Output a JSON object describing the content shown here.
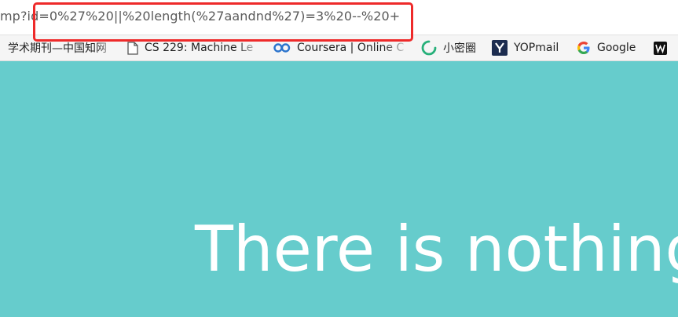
{
  "address_bar": {
    "url": "mp?id=0%27%20||%20length(%27aandnd%27)=3%20--%20+"
  },
  "bookmarks": [
    {
      "label": "学术期刊—中国知网",
      "icon": "cnki-icon"
    },
    {
      "label": "CS 229: Machine Le",
      "icon": "document-icon"
    },
    {
      "label": "Coursera | Online C",
      "icon": "coursera-icon"
    },
    {
      "label": "小密圈",
      "icon": "xiaomiquan-icon"
    },
    {
      "label": "YOPmail",
      "icon": "yopmail-icon"
    },
    {
      "label": "Google",
      "icon": "google-icon"
    },
    {
      "label": "",
      "icon": "wordpress-icon"
    }
  ],
  "page": {
    "message": "There is nothing"
  },
  "colors": {
    "page_background": "#66cccc",
    "highlight_box": "#ee2a2a",
    "message_text": "#ffffff"
  }
}
